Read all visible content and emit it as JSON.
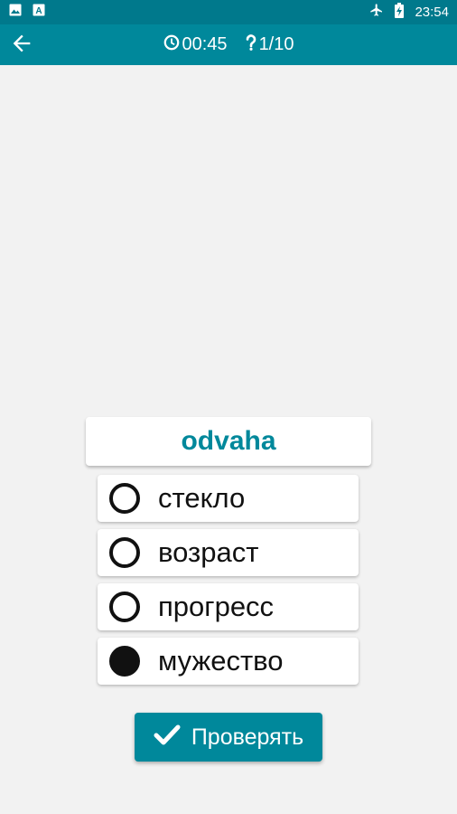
{
  "status_bar": {
    "time": "23:54",
    "icons": [
      "image-icon",
      "text-a-icon",
      "airplane-icon",
      "battery-charging-icon"
    ]
  },
  "header": {
    "back_icon": "arrow-left-icon",
    "timer_icon": "clock-icon",
    "timer": "00:45",
    "question_icon": "question-icon",
    "progress": "1/10"
  },
  "quiz": {
    "word": "odvaha",
    "options": [
      {
        "label": "стекло",
        "selected": false
      },
      {
        "label": "возраст",
        "selected": false
      },
      {
        "label": "прогресс",
        "selected": false
      },
      {
        "label": "мужество",
        "selected": true
      }
    ],
    "check_label": "Проверять",
    "check_icon": "checkmark-icon"
  },
  "colors": {
    "status_bar": "#00798c",
    "app_bar": "#00889b",
    "accent": "#00889b",
    "background": "#f2f2f2"
  }
}
